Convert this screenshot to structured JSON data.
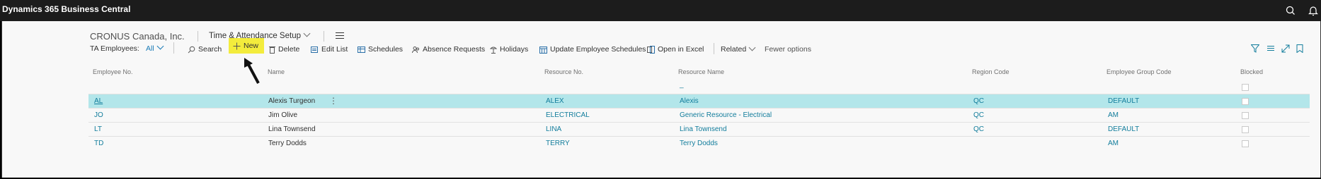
{
  "app": {
    "title": "Dynamics 365 Business Central"
  },
  "nav": {
    "company": "CRONUS Canada, Inc.",
    "page_title": "Time & Attendance Setup"
  },
  "actions": {
    "list_label": "TA Employees:",
    "view_filter": "All",
    "search": "Search",
    "new": "New",
    "delete": "Delete",
    "edit_list": "Edit List",
    "schedules": "Schedules",
    "absence_requests": "Absence Requests",
    "holidays": "Holidays",
    "update_schedules": "Update Employee Schedules",
    "open_excel": "Open in Excel",
    "related": "Related",
    "fewer_options": "Fewer options"
  },
  "table": {
    "columns": [
      "Employee No.",
      "Name",
      "Resource No.",
      "Resource Name",
      "Region Code",
      "Employee Group Code",
      "Blocked"
    ],
    "filter_marker": "_",
    "rows": [
      {
        "no": "AL",
        "name": "Alexis Turgeon",
        "resource_no": "ALEX",
        "resource_name": "Alexis",
        "region": "QC",
        "group": "DEFAULT",
        "blocked": false,
        "selected": true
      },
      {
        "no": "JO",
        "name": "Jim Olive",
        "resource_no": "ELECTRICAL",
        "resource_name": "Generic Resource - Electrical",
        "region": "QC",
        "group": "AM",
        "blocked": false,
        "selected": false
      },
      {
        "no": "LT",
        "name": "Lina Townsend",
        "resource_no": "LINA",
        "resource_name": "Lina Townsend",
        "region": "QC",
        "group": "DEFAULT",
        "blocked": false,
        "selected": false
      },
      {
        "no": "TD",
        "name": "Terry Dodds",
        "resource_no": "TERRY",
        "resource_name": "Terry Dodds",
        "region": "",
        "group": "AM",
        "blocked": false,
        "selected": false
      }
    ]
  },
  "colors": {
    "accent": "#127d9c",
    "selected_row": "#b3e6ea",
    "highlight": "#f3ec3c"
  }
}
